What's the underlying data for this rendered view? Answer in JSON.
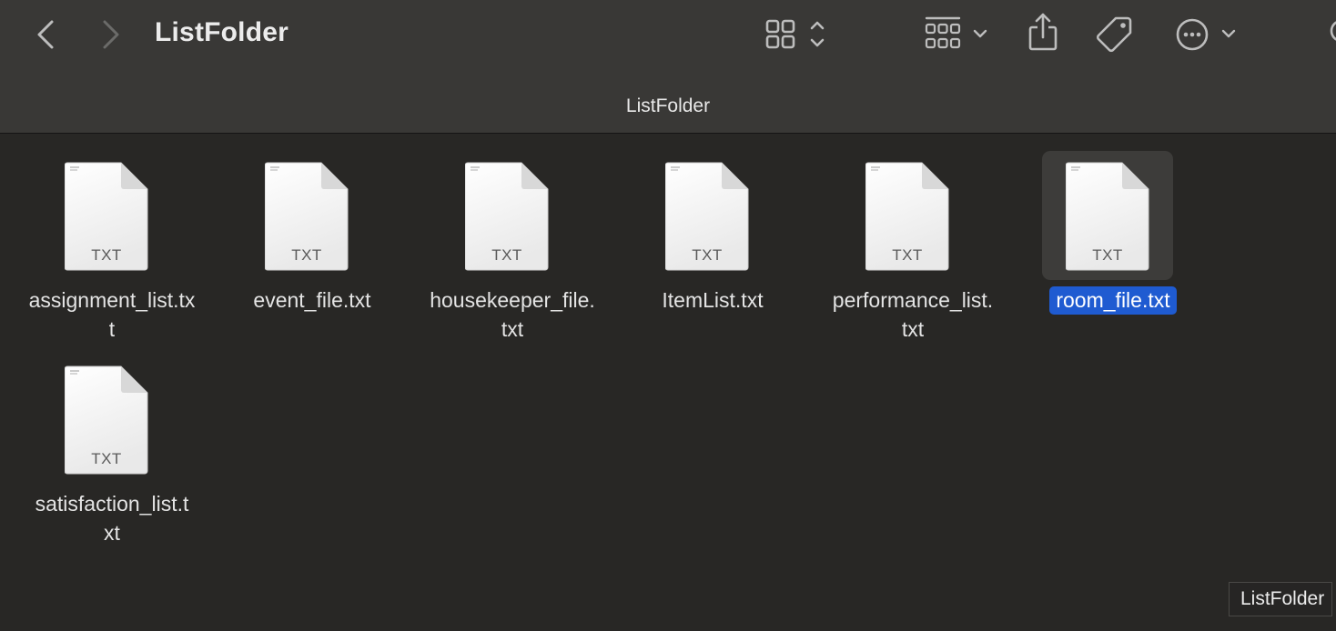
{
  "window": {
    "title": "ListFolder",
    "path_title": "ListFolder",
    "tooltip": "ListFolder"
  },
  "toolbar": {
    "back_icon": "chevron-left-icon",
    "forward_icon": "chevron-right-icon",
    "view_icon": "grid-view-icon",
    "group_icon": "group-by-icon",
    "share_icon": "share-icon",
    "tag_icon": "tag-icon",
    "more_icon": "ellipsis-circle-icon"
  },
  "files": [
    {
      "name": "assignment_list.txt",
      "line1": "assignment_list.tx",
      "line2": "t",
      "kind": "TXT",
      "selected": false
    },
    {
      "name": "event_file.txt",
      "line1": "event_file.txt",
      "line2": "",
      "kind": "TXT",
      "selected": false
    },
    {
      "name": "housekeeper_file.txt",
      "line1": "housekeeper_file.",
      "line2": "txt",
      "kind": "TXT",
      "selected": false
    },
    {
      "name": "ItemList.txt",
      "line1": "ItemList.txt",
      "line2": "",
      "kind": "TXT",
      "selected": false
    },
    {
      "name": "performance_list.txt",
      "line1": "performance_list.",
      "line2": "txt",
      "kind": "TXT",
      "selected": false
    },
    {
      "name": "room_file.txt",
      "line1": "room_file.txt",
      "line2": "",
      "kind": "TXT",
      "selected": true
    },
    {
      "name": "satisfaction_list.txt",
      "line1": "satisfaction_list.t",
      "line2": "xt",
      "kind": "TXT",
      "selected": false
    }
  ],
  "colors": {
    "selection": "#1f5bd1",
    "toolbar_bg": "#393836",
    "content_bg": "#282725"
  }
}
